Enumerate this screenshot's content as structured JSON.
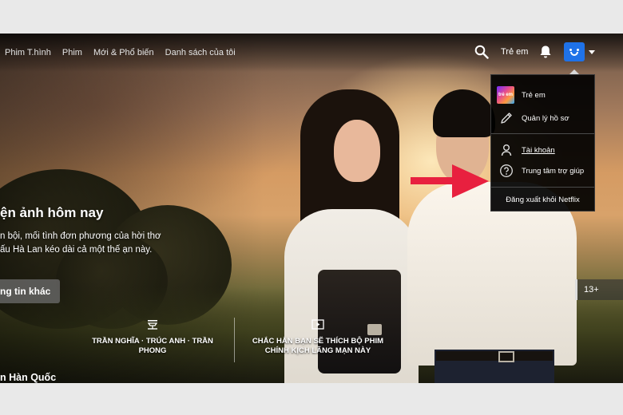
{
  "nav": {
    "links": [
      "Phim T.hình",
      "Phim",
      "Mới & Phổ biến",
      "Danh sách của tôi"
    ],
    "kids_label": "Trẻ em"
  },
  "account_menu": {
    "kids_profile": "Trẻ em",
    "kids_thumb_text": "trẻ em",
    "manage_profiles": "Quản lý hồ sơ",
    "account": "Tài khoản",
    "help_center": "Trung tâm trợ giúp",
    "sign_out": "Đăng xuất khỏi Netflix"
  },
  "hero": {
    "title": "ện ảnh hôm nay",
    "description": "n bội, mối tình đơn phương của hời thơ ấu Hà Lan kéo dài cả một thế ạn này.",
    "more_info_button": "ng tin khác",
    "maturity_rating": "13+"
  },
  "tags": [
    {
      "icon": "cast-icon",
      "text": "TRẦN NGHĨA · TRÚC ANH · TRẦN PHONG"
    },
    {
      "icon": "play-icon",
      "text": "CHẮC HẲN BẠN SẼ THÍCH BỘ PHIM CHÍNH KỊCH LÃNG MẠN NÀY"
    }
  ],
  "row_title": "n Hàn Quốc",
  "colors": {
    "brand_red": "#e50914",
    "annotation_arrow": "#e8203f",
    "avatar_blue": "#1f72e8"
  }
}
